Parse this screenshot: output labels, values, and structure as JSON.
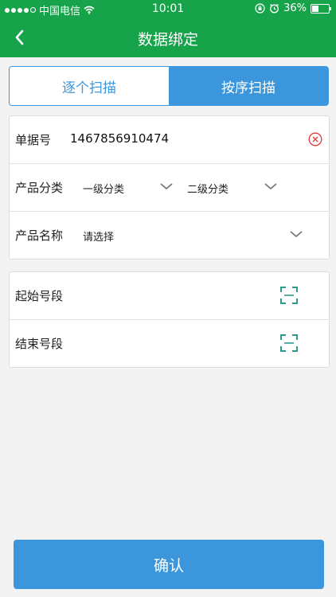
{
  "status": {
    "carrier": "中国电信",
    "time": "10:01",
    "battery": "36%"
  },
  "nav": {
    "title": "数据绑定"
  },
  "tabs": [
    {
      "label": "逐个扫描",
      "active": false
    },
    {
      "label": "按序扫描",
      "active": true
    }
  ],
  "form": {
    "doc_no_label": "单据号",
    "doc_no_value": "1467856910474",
    "category_label": "产品分类",
    "category_level1": "一级分类",
    "category_level2": "二级分类",
    "name_label": "产品名称",
    "name_value": "请选择"
  },
  "range": {
    "start_label": "起始号段",
    "end_label": "结束号段"
  },
  "confirm_label": "确认",
  "colors": {
    "nav_green": "#16a34a",
    "accent_blue": "#3c96dc",
    "clear_red": "#e53935",
    "scan_teal": "#2e9a8a"
  },
  "icons": [
    "wifi-icon",
    "back-icon",
    "clear-icon",
    "chevron-down-icon",
    "scan-icon"
  ]
}
